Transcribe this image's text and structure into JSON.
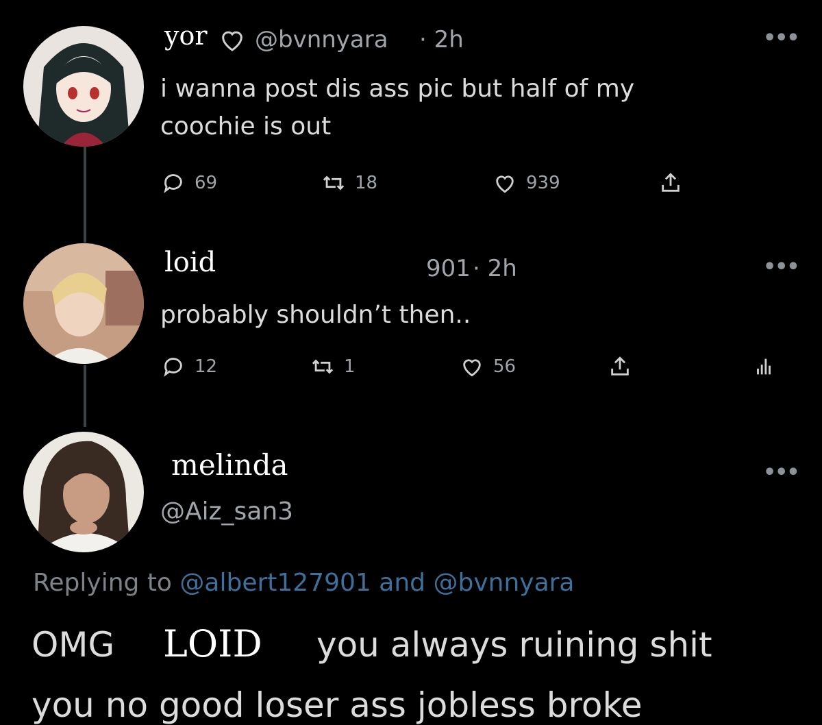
{
  "tweets": [
    {
      "name": "yor",
      "handle": "@bvnnyara",
      "time": "· 2h",
      "text_line1": "i wanna post dis ass pic but half of my",
      "text_line2": "coochie is out",
      "replies": "69",
      "retweets": "18",
      "likes": "939"
    },
    {
      "name": "loid",
      "handle_partial": "901",
      "time": "· 2h",
      "text": "probably shouldn’t then..",
      "replies": "12",
      "retweets": "1",
      "likes": "56"
    },
    {
      "name": "melinda",
      "handle": "@Aiz_san3",
      "replying_prefix": "Replying to",
      "reply_user1": "@albert127901",
      "reply_and": "and",
      "reply_user2": "@bvnnyara",
      "text_word1": "OMG",
      "text_name": "LOID",
      "text_rest": "you always ruining shit",
      "text_line2": "you no good loser ass jobless broke"
    }
  ],
  "icons": [
    "reply-icon",
    "retweet-icon",
    "like-icon",
    "share-icon",
    "heart-outline-icon",
    "analytics-icon",
    "more-icon"
  ],
  "colors": {
    "background": "#000000",
    "link": "#3f6f9b",
    "text": "#dcdcdc",
    "muted": "#a0a6ab"
  }
}
